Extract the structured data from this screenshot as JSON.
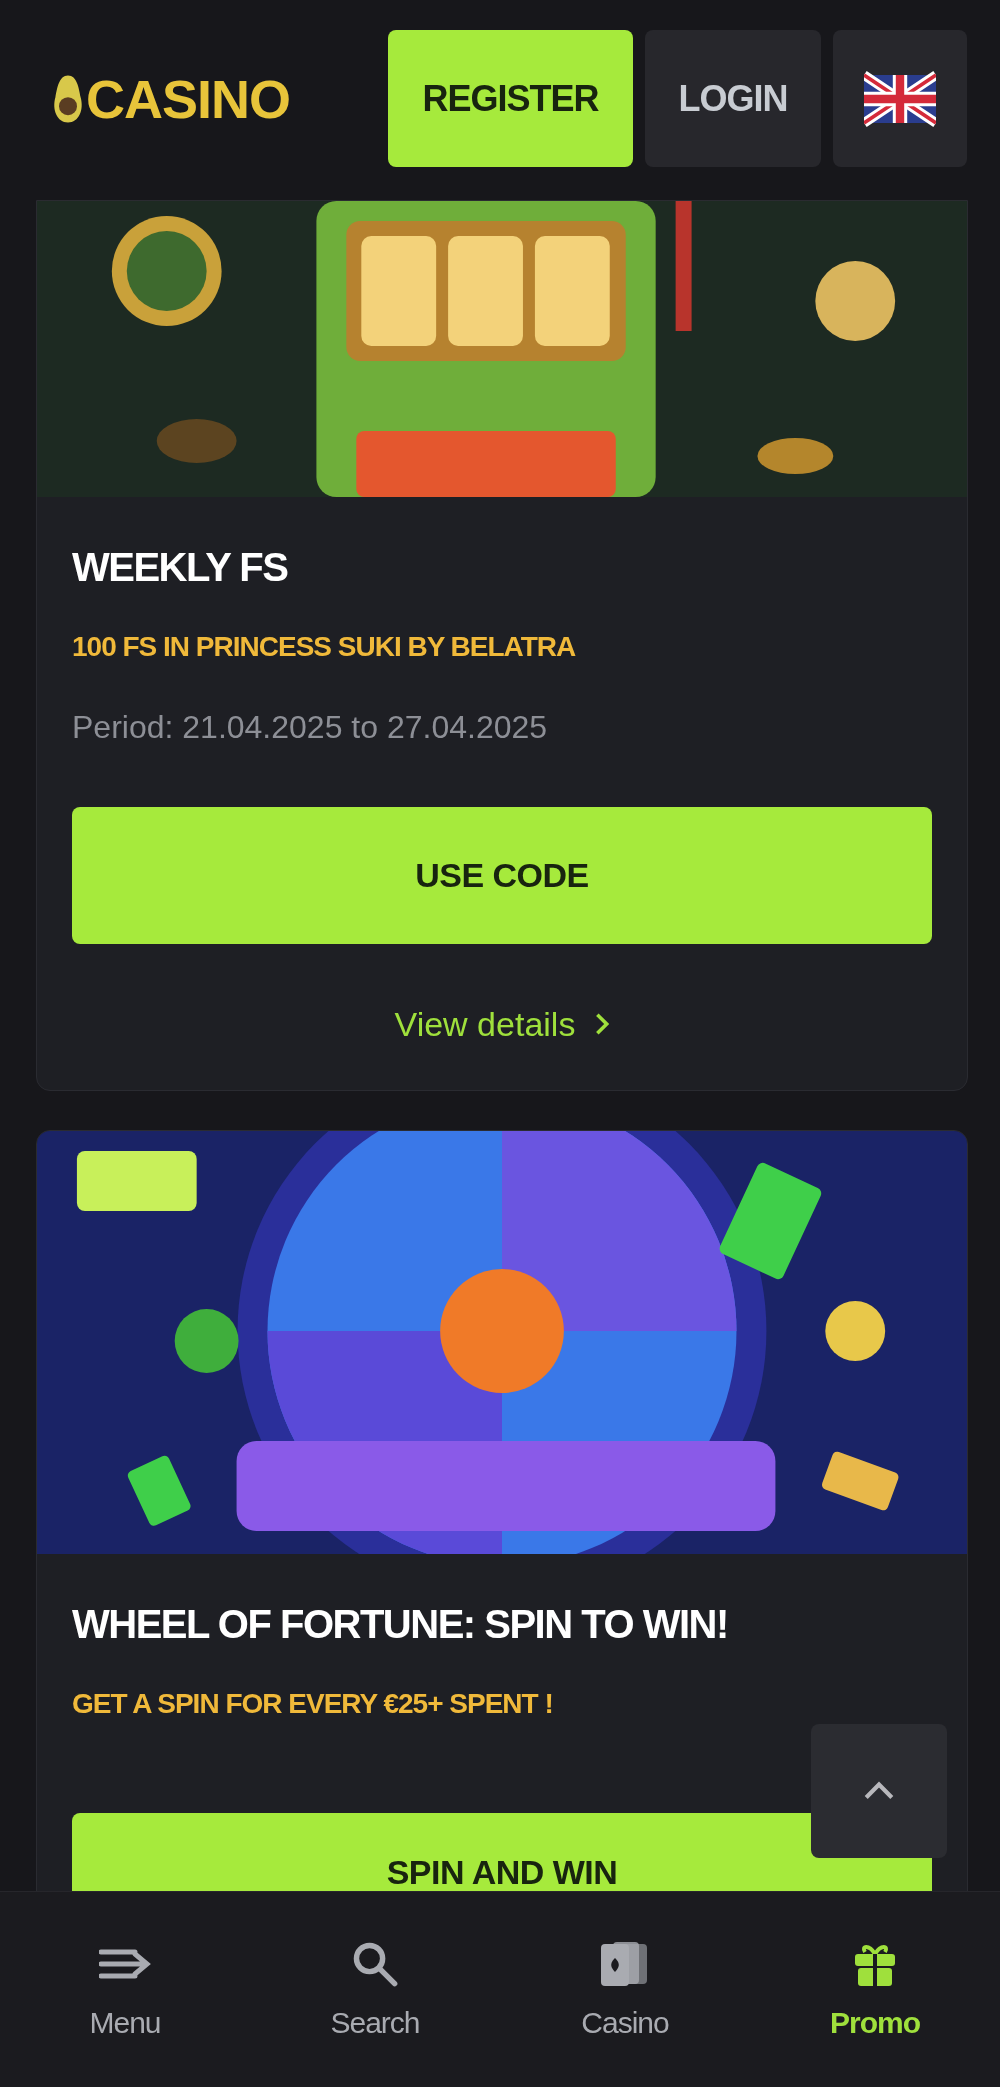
{
  "header": {
    "logo": "CASINO",
    "buttons": [
      {
        "label": "REGISTER",
        "kind": "primary"
      },
      {
        "label": "LOGIN",
        "kind": "secondary"
      }
    ]
  },
  "promotions": [
    {
      "title": "WEEKLY FS",
      "subtitle": "100 FS IN PRINCESS SUKI BY BELATRA",
      "period": "Period: 21.04.2025 to 27.04.2025",
      "button": "USE CODE",
      "details_link": "View details"
    },
    {
      "title": "WHEEL OF FORTUNE: SPIN TO WIN!",
      "subtitle": "GET A SPIN FOR EVERY €25+ SPENT !",
      "button": "SPIN AND WIN"
    }
  ],
  "bottom_nav": [
    {
      "label": "Menu",
      "selected": false
    },
    {
      "label": "Search",
      "selected": false
    },
    {
      "label": "Casino",
      "selected": false
    },
    {
      "label": "Promo",
      "selected": true
    }
  ]
}
